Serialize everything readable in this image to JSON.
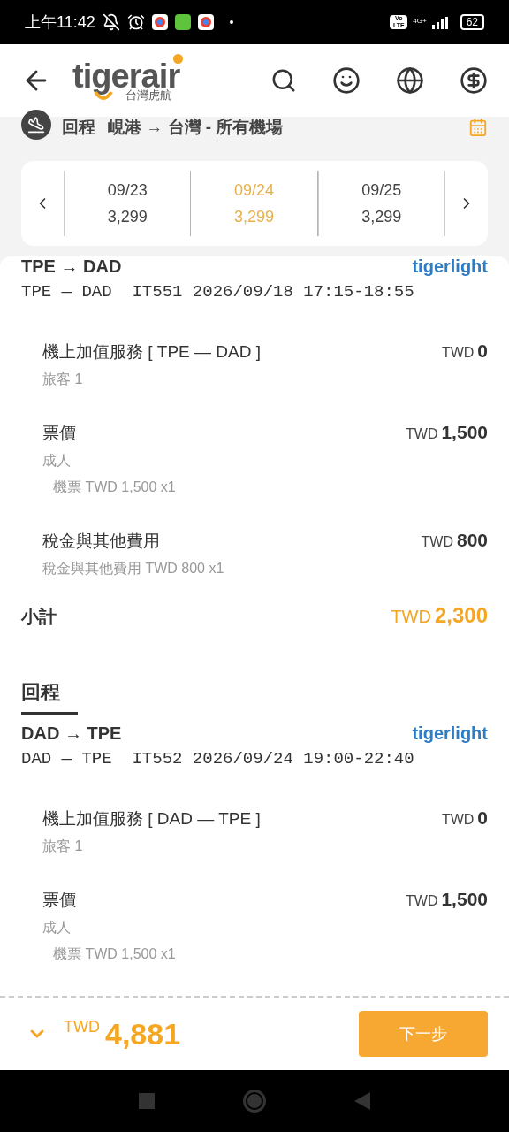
{
  "status_bar": {
    "time": "上午11:42",
    "network": "4G+",
    "volte": "Vo LTE",
    "battery": "62"
  },
  "header": {
    "wordmark": "tigerair",
    "subtitle": "台灣虎航"
  },
  "trip_bar": {
    "label": "回程",
    "route": "峴港 → 台灣 - 所有機場"
  },
  "dates": [
    {
      "date": "09/23",
      "price": "3,299",
      "selected": false
    },
    {
      "date": "09/24",
      "price": "3,299",
      "selected": true
    },
    {
      "date": "09/25",
      "price": "3,299",
      "selected": false
    }
  ],
  "legs": [
    {
      "route": "TPE → DAD",
      "fare": "tigerlight",
      "flight": "TPE — DAD  IT551 2026/09/18 17:15-18:55",
      "items": [
        {
          "label": "機上加值服務 [ TPE — DAD ]",
          "currency": "TWD",
          "amount": "0",
          "details": [
            {
              "kind": "line",
              "text": "旅客 1"
            }
          ]
        },
        {
          "label": "票價",
          "currency": "TWD",
          "amount": "1,500",
          "details": [
            {
              "kind": "line",
              "text": "成人"
            },
            {
              "kind": "sub",
              "text": "機票 TWD 1,500 x1"
            }
          ]
        },
        {
          "label": "稅金與其他費用",
          "currency": "TWD",
          "amount": "800",
          "details": [
            {
              "kind": "line",
              "text": "稅金與其他費用 TWD 800 x1"
            }
          ]
        }
      ],
      "subtotal": {
        "label": "小計",
        "currency": "TWD",
        "amount": "2,300"
      }
    },
    {
      "heading": "回程",
      "route": "DAD → TPE",
      "fare": "tigerlight",
      "flight": "DAD — TPE  IT552 2026/09/24 19:00-22:40",
      "items": [
        {
          "label": "機上加值服務 [ DAD — TPE ]",
          "currency": "TWD",
          "amount": "0",
          "details": [
            {
              "kind": "line",
              "text": "旅客 1"
            }
          ]
        },
        {
          "label": "票價",
          "currency": "TWD",
          "amount": "1,500",
          "details": [
            {
              "kind": "line",
              "text": "成人"
            },
            {
              "kind": "sub",
              "text": "機票 TWD 1,500 x1"
            }
          ]
        }
      ]
    }
  ],
  "footer": {
    "currency": "TWD",
    "total": "4,881",
    "next_button": "下一步"
  }
}
